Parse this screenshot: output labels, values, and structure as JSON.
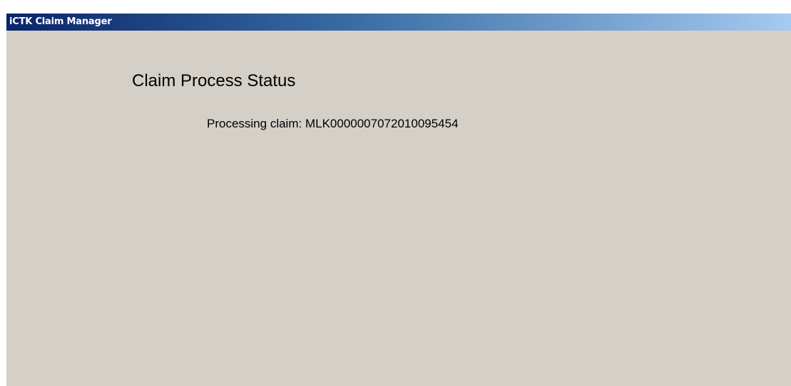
{
  "window": {
    "title": "iCTK Claim Manager"
  },
  "main": {
    "heading": "Claim Process Status",
    "status_label": "Processing claim:",
    "claim_id": "MLK0000007072010095454"
  },
  "colors": {
    "titlebar_start": "#0a246a",
    "titlebar_end": "#a6caf0",
    "window_background": "#d4d0c8",
    "text": "#000000"
  }
}
